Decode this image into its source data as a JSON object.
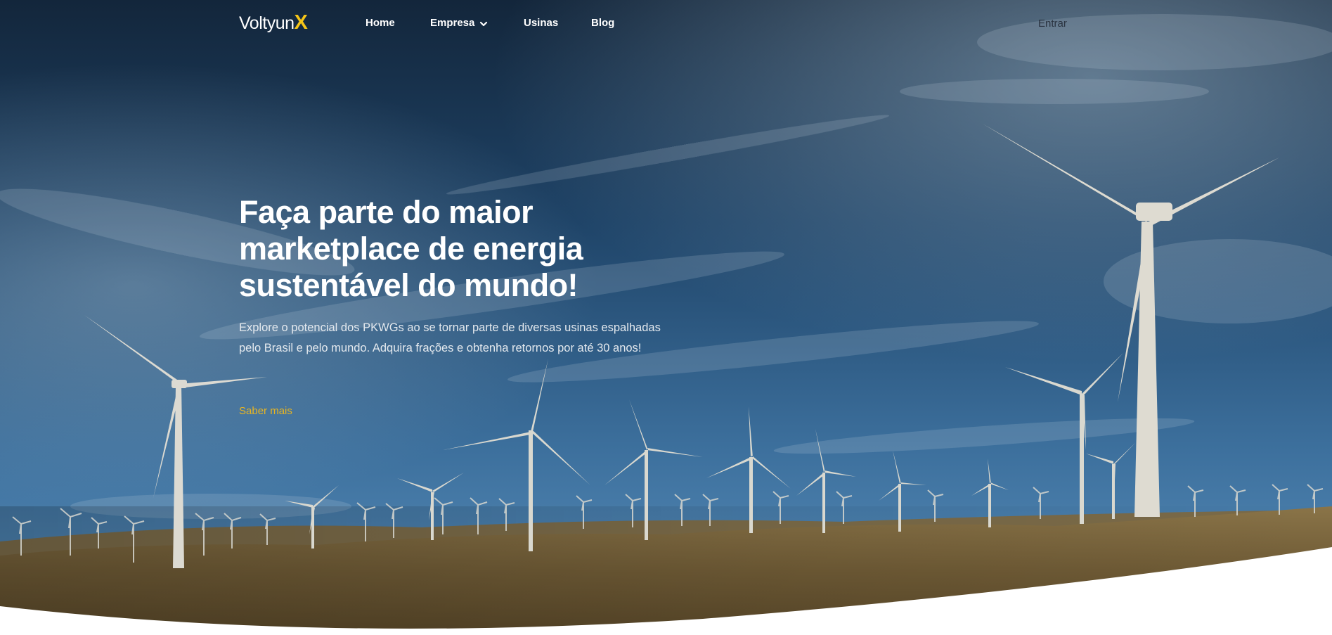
{
  "brand": {
    "name_prefix": "Voltyun",
    "name_suffix": "X"
  },
  "nav": {
    "items": [
      {
        "label": "Home"
      },
      {
        "label": "Empresa"
      },
      {
        "label": "Usinas"
      },
      {
        "label": "Blog"
      }
    ],
    "login_label": "Entrar"
  },
  "hero": {
    "title": "Faça parte do maior marketplace de energia sustentável do mundo!",
    "subtitle": "Explore o potencial dos PKWGs ao se tornar parte de diversas usinas espalhadas pelo Brasil e pelo mundo. Adquira frações e obtenha retornos por até 30 anos!",
    "cta_label": "Saber mais",
    "background": "wind-farm-photo"
  },
  "colors": {
    "accent": "#f5c518",
    "cta": "#e8b522",
    "sky_top": "#13263b",
    "sky_bottom": "#4f85b3",
    "ground": "#6f5a34"
  }
}
